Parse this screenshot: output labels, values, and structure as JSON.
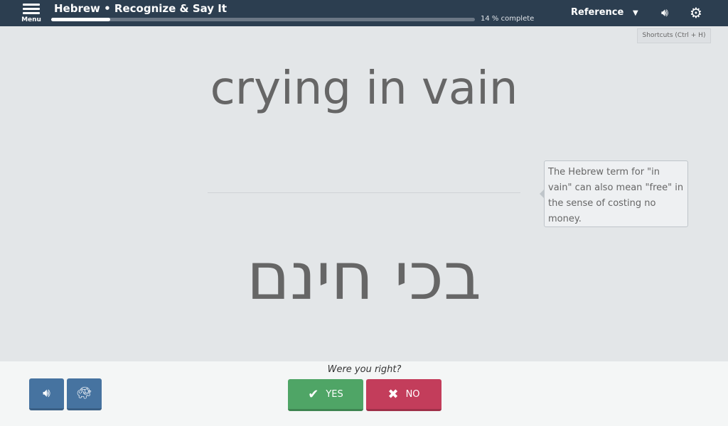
{
  "header": {
    "menu_label": "Menu",
    "title": "Hebrew • Recognize & Say It",
    "progress_percent": 14,
    "progress_text": "14 % complete",
    "reference_label": "Reference",
    "shortcuts_label": "Shortcuts (Ctrl + H)"
  },
  "card": {
    "prompt": "crying in vain",
    "answer": "בכי חינם",
    "tooltip": "The Hebrew term for \"in vain\" can also mean \"free\" in the sense of costing no money."
  },
  "footer": {
    "question": "Were you right?",
    "yes_label": "YES",
    "no_label": "NO"
  },
  "colors": {
    "header": "#2c3e50",
    "yes": "#4fa566",
    "no": "#c33d5b",
    "audio": "#4673a0"
  }
}
